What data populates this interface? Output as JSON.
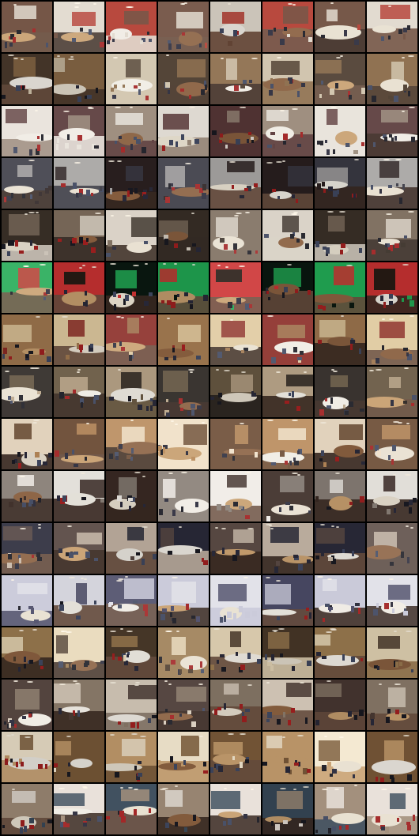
{
  "grid": {
    "rows": 16,
    "cols": 8,
    "count": 128,
    "background": "#000000",
    "palette": [
      [
        "#6b4a3a",
        "#e0d8cc",
        "#b23a2e"
      ],
      [
        "#8a6a48",
        "#cfc2aa",
        "#4a3a2c"
      ],
      [
        "#9a8a7a",
        "#e8e2da",
        "#5a3a3a"
      ],
      [
        "#3a3a44",
        "#a8a6a4",
        "#2a2020"
      ],
      [
        "#7a6a5a",
        "#d8d0c4",
        "#3a3028"
      ],
      [
        "#0a1810",
        "#22aa55",
        "#cc3333"
      ],
      [
        "#a07850",
        "#e0caa0",
        "#8a2a24"
      ],
      [
        "#6a5a44",
        "#b8a488",
        "#2a2420"
      ],
      [
        "#b88a5a",
        "#f0e0c8",
        "#6a4a32"
      ],
      [
        "#8a8078",
        "#f0ece6",
        "#3a2a24"
      ],
      [
        "#5a4a44",
        "#c8b8a8",
        "#2a2a3a"
      ],
      [
        "#4a4a66",
        "#c8c8d8",
        "#e0e0e8"
      ],
      [
        "#9a7a50",
        "#e8d8b8",
        "#4a3a2a"
      ],
      [
        "#8a7a6a",
        "#d8ccbc",
        "#4a3a34"
      ],
      [
        "#c8a070",
        "#f4e8d0",
        "#7a5a3a"
      ],
      [
        "#a08c78",
        "#e8e0d8",
        "#3a4a5a"
      ]
    ]
  }
}
